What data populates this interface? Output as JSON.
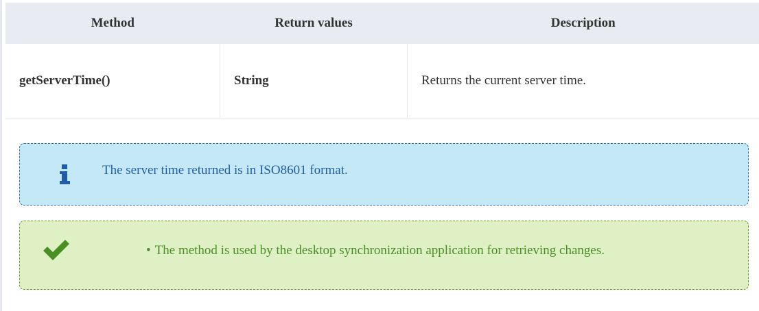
{
  "table": {
    "headers": [
      "Method",
      "Return values",
      "Description"
    ],
    "rows": [
      {
        "method": "getServerTime()",
        "returns": "String",
        "description": "Returns the current server time."
      }
    ]
  },
  "info_note": {
    "icon": "info-icon",
    "text": "The server time returned is in ISO8601 format."
  },
  "tip_note": {
    "icon": "checkmark-icon",
    "items": [
      "The method is used by the desktop synchronization application for retrieving changes."
    ]
  },
  "colors": {
    "header_bg": "#e8ecf2",
    "info_bg": "#c5e8f7",
    "info_text": "#1f5ea6",
    "tip_bg": "#def0c4",
    "tip_text": "#4a8f24"
  }
}
